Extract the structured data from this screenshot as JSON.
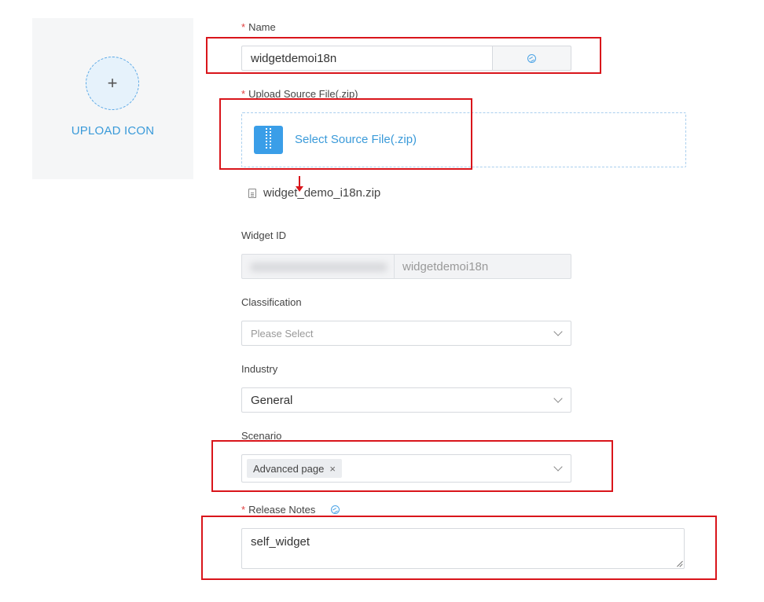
{
  "upload": {
    "plus": "+",
    "label": "UPLOAD ICON"
  },
  "name": {
    "required": "*",
    "label": "Name",
    "value": "widgetdemoi18n",
    "addon_icon": "globe-icon"
  },
  "source": {
    "required": "*",
    "label": "Upload Source File(.zip)",
    "button_label": "Select Source File(.zip)",
    "icon": "zip-file-icon",
    "file_name": "widget_demo_i18n.zip"
  },
  "widget_id": {
    "label": "Widget ID",
    "value": "widgetdemoi18n"
  },
  "classification": {
    "label": "Classification",
    "placeholder": "Please Select"
  },
  "industry": {
    "label": "Industry",
    "value": "General"
  },
  "scenario": {
    "label": "Scenario",
    "tags": [
      "Advanced page"
    ],
    "remove_symbol": "×"
  },
  "release_notes": {
    "required": "*",
    "label": "Release Notes",
    "value": "self_widget",
    "icon": "globe-icon"
  },
  "colors": {
    "accent": "#3a9ad9",
    "highlight": "#d9151b",
    "required": "#e04040"
  }
}
